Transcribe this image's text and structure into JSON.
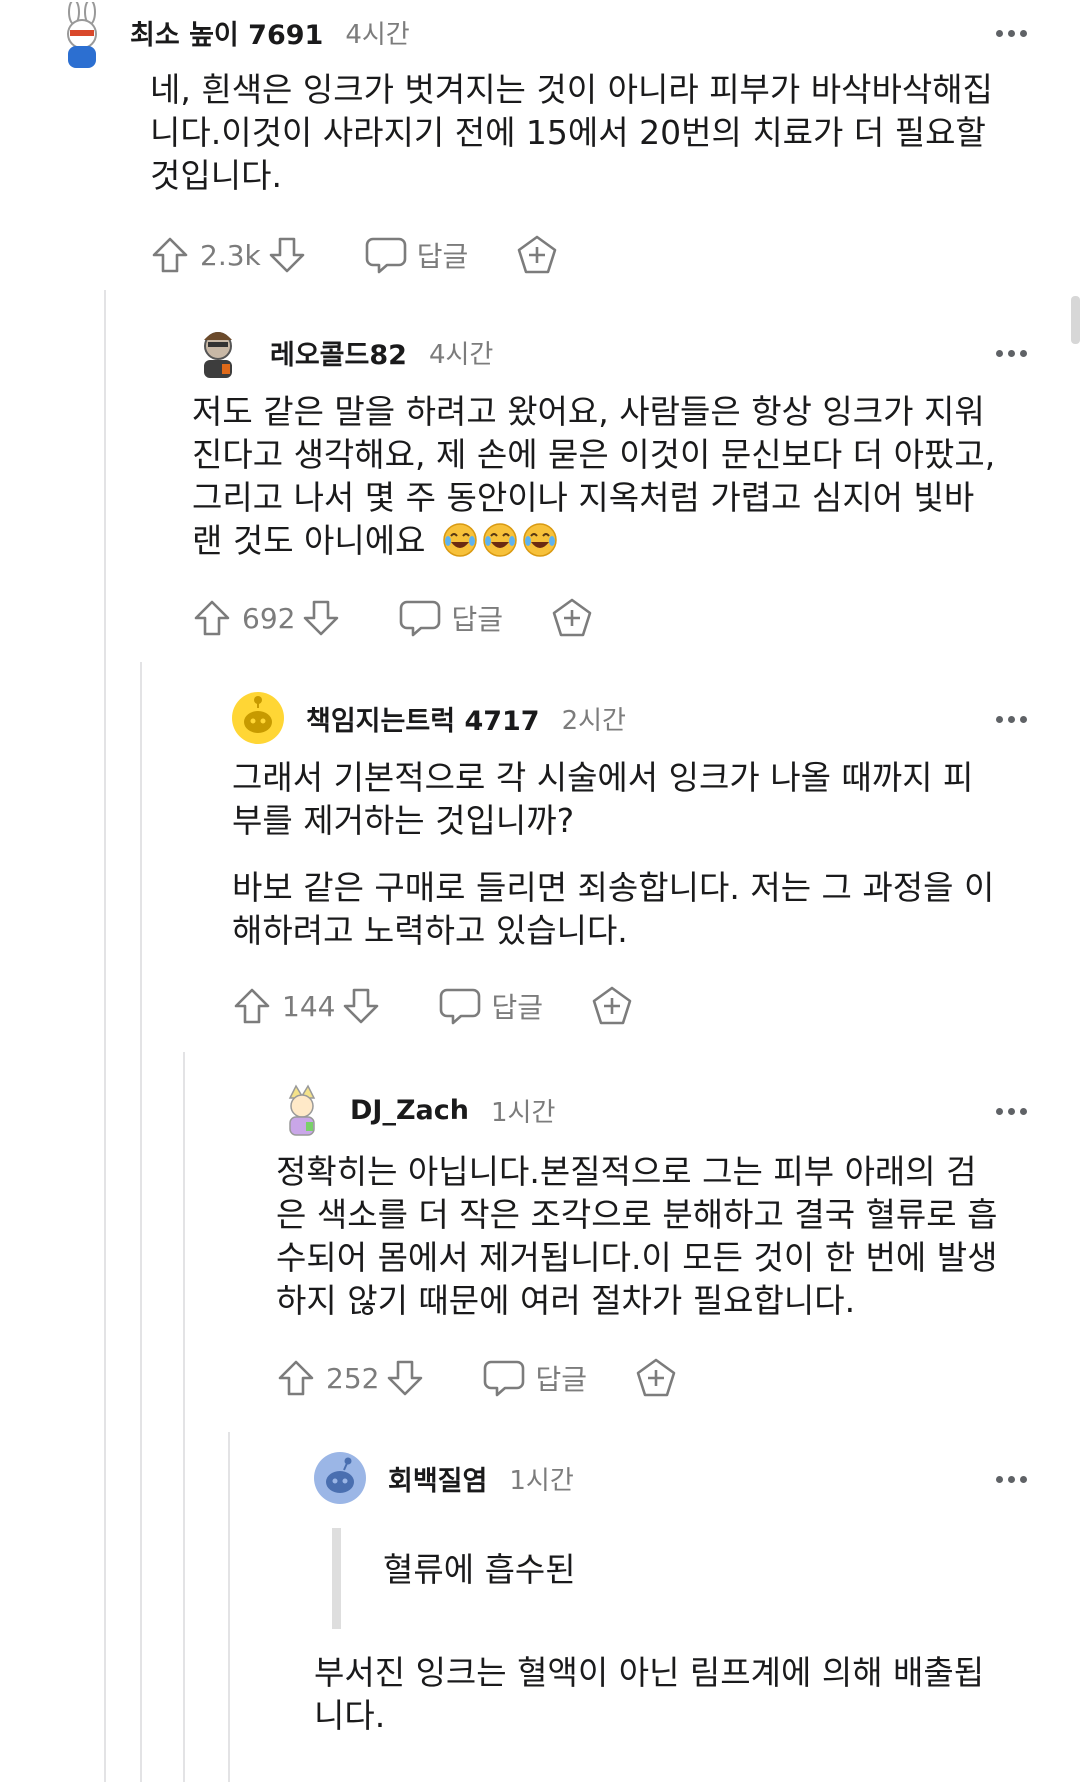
{
  "comments": [
    {
      "username": "최소 높이 7691",
      "time": "4시간",
      "lines": [
        "네, 흰색은 잉크가 벗겨지는 것이 아니라 피부가 바삭바삭해집",
        "니다.이것이 사라지기 전에 15에서 20번의 치료가 더 필요할",
        "것입니다."
      ],
      "votes": "2.3k",
      "reply_label": "답글"
    },
    {
      "username": "레오콜드82",
      "time": "4시간",
      "lines": [
        "저도 같은 말을 하려고 왔어요, 사람들은 항상 잉크가 지워",
        "진다고 생각해요, 제 손에 묻은 이것이 문신보다 더 아팠고,",
        "그리고 나서 몇 주 동안이나 지옥처럼 가렵고 심지어 빛바",
        "랜 것도 아니에요"
      ],
      "votes": "692",
      "reply_label": "답글"
    },
    {
      "username": "책임지는트럭 4717",
      "time": "2시간",
      "lines": [
        "그래서 기본적으로 각 시술에서 잉크가 나올 때까지 피",
        "부를 제거하는 것입니까?"
      ],
      "lines2": [
        "바보 같은 구매로 들리면 죄송합니다. 저는 그 과정을 이",
        "해하려고 노력하고 있습니다."
      ],
      "votes": "144",
      "reply_label": "답글"
    },
    {
      "username": "DJ_Zach",
      "time": "1시간",
      "lines": [
        "정확히는 아닙니다.본질적으로 그는 피부 아래의 검",
        "은 색소를 더 작은 조각으로 분해하고 결국 혈류로 흡",
        "수되어 몸에서 제거됩니다.이 모든 것이 한 번에 발생",
        "하지 않기 때문에 여러 절차가 필요합니다."
      ],
      "votes": "252",
      "reply_label": "답글"
    },
    {
      "username": "회백질염",
      "time": "1시간",
      "quote": "혈류에 흡수된",
      "lines": [
        "부서진 잉크는 혈액이 아닌 림프계에 의해 배출됩",
        "니다."
      ]
    }
  ],
  "icons": {
    "upvote": "upvote-arrow-icon",
    "downvote": "downvote-arrow-icon",
    "reply": "speech-bubble-icon",
    "award": "award-plus-icon",
    "more": "more-dots-icon",
    "emoji": "face-with-tears-of-joy-icon"
  },
  "colors": {
    "text": "#1a1a1b",
    "meta": "#7c7c7c",
    "thread_line": "#e3e3e5"
  }
}
